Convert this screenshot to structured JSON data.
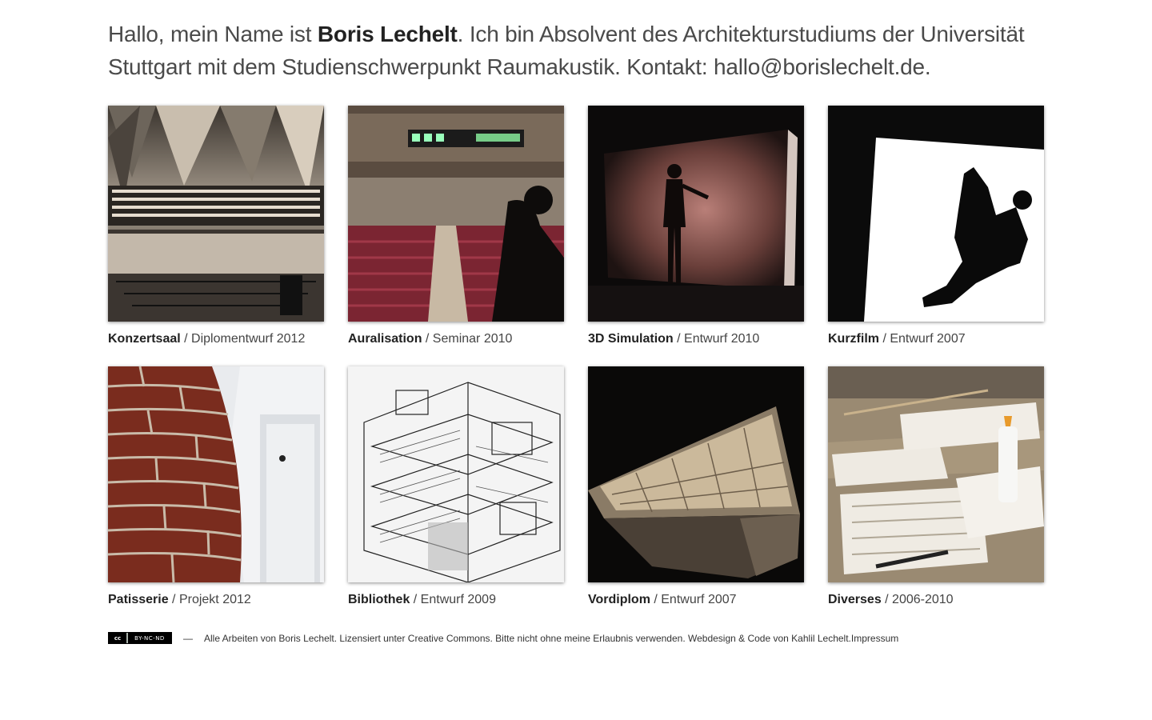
{
  "intro": {
    "pre": "Hallo, mein Name ist ",
    "name": "Boris Lechelt",
    "post": ". Ich bin Absolvent des Architekturstudiums der Universität Stuttgart mit dem Studienschwerpunkt Raumakustik. Kontakt: hallo@borislechelt.de."
  },
  "projects": [
    {
      "title": "Konzertsaal",
      "sub": " / Diplomentwurf 2012",
      "icon": "concert-hall-photo"
    },
    {
      "title": "Auralisation",
      "sub": " / Seminar 2010",
      "icon": "vr-auralisation-photo"
    },
    {
      "title": "3D Simulation",
      "sub": " / Entwurf 2010",
      "icon": "cave-simulation-photo"
    },
    {
      "title": "Kurzfilm",
      "sub": " / Entwurf 2007",
      "icon": "silhouette-photo"
    },
    {
      "title": "Patisserie",
      "sub": " / Projekt 2012",
      "icon": "brick-door-photo"
    },
    {
      "title": "Bibliothek",
      "sub": " / Entwurf 2009",
      "icon": "library-drawing"
    },
    {
      "title": "Vordiplom",
      "sub": " / Entwurf 2007",
      "icon": "model-photo"
    },
    {
      "title": "Diverses",
      "sub": " / 2006-2010",
      "icon": "workshop-photo"
    }
  ],
  "footer": {
    "cc_label": "cc",
    "cc_text": "BY-NC-ND",
    "dash": "—",
    "text": "Alle Arbeiten von Boris Lechelt. Lizensiert unter Creative Commons. Bitte nicht ohne meine Erlaubnis verwenden. Webdesign & Code von Kahlil Lechelt. ",
    "impressum": "Impressum"
  }
}
